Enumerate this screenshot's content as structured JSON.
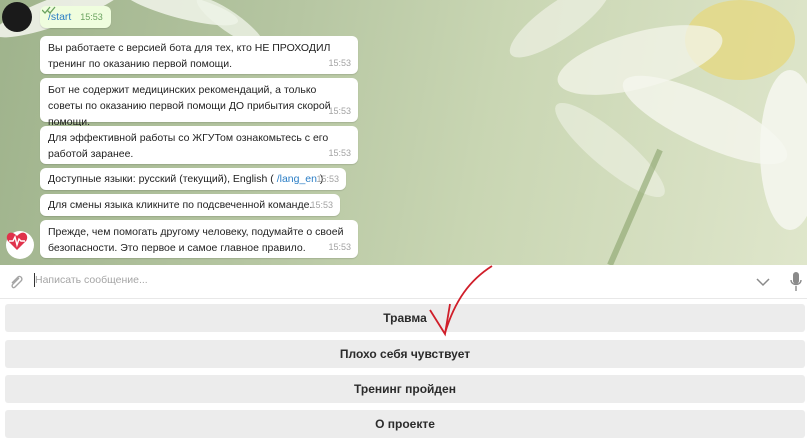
{
  "messages": {
    "outgoing": {
      "text": "/start",
      "time": "15:53",
      "status_icon": "double-check-icon"
    },
    "incoming": [
      {
        "text": "Вы работаете с версией бота для тех, кто НЕ ПРОХОДИЛ тренинг по оказанию первой помощи.",
        "time": "15:53"
      },
      {
        "text": "Бот не содержит медицинских рекомендаций, а только советы по оказанию первой помощи ДО прибытия скорой помощи.",
        "time": "15:53"
      },
      {
        "text": "Для эффективной работы со ЖГУТом ознакомьтесь с его работой заранее.",
        "time": "15:53"
      },
      {
        "text_before": "Доступные языки: русский (текущий), English ( ",
        "link": "/lang_en",
        "text_after": " )",
        "time": "15:53"
      },
      {
        "text": "Для смены языка кликните по подсвеченной команде.",
        "time": "15:53"
      },
      {
        "text": "Прежде, чем помогать другому человеку, подумайте о своей безопасности. Это первое и самое главное правило.",
        "time": "15:53"
      }
    ]
  },
  "input": {
    "placeholder": "Написать сообщение...",
    "attach_icon": "paperclip-icon",
    "keyboard_icon": "chevron-down-icon",
    "mic_icon": "microphone-icon"
  },
  "keyboard": {
    "buttons": [
      "Травма",
      "Плохо себя чувствует",
      "Тренинг пройден",
      "О проекте"
    ]
  },
  "colors": {
    "link": "#2a7dc5",
    "outgoing_bubble": "#effdde",
    "annotation_arrow": "#d01e2a",
    "bot_avatar": "#e0324b"
  }
}
